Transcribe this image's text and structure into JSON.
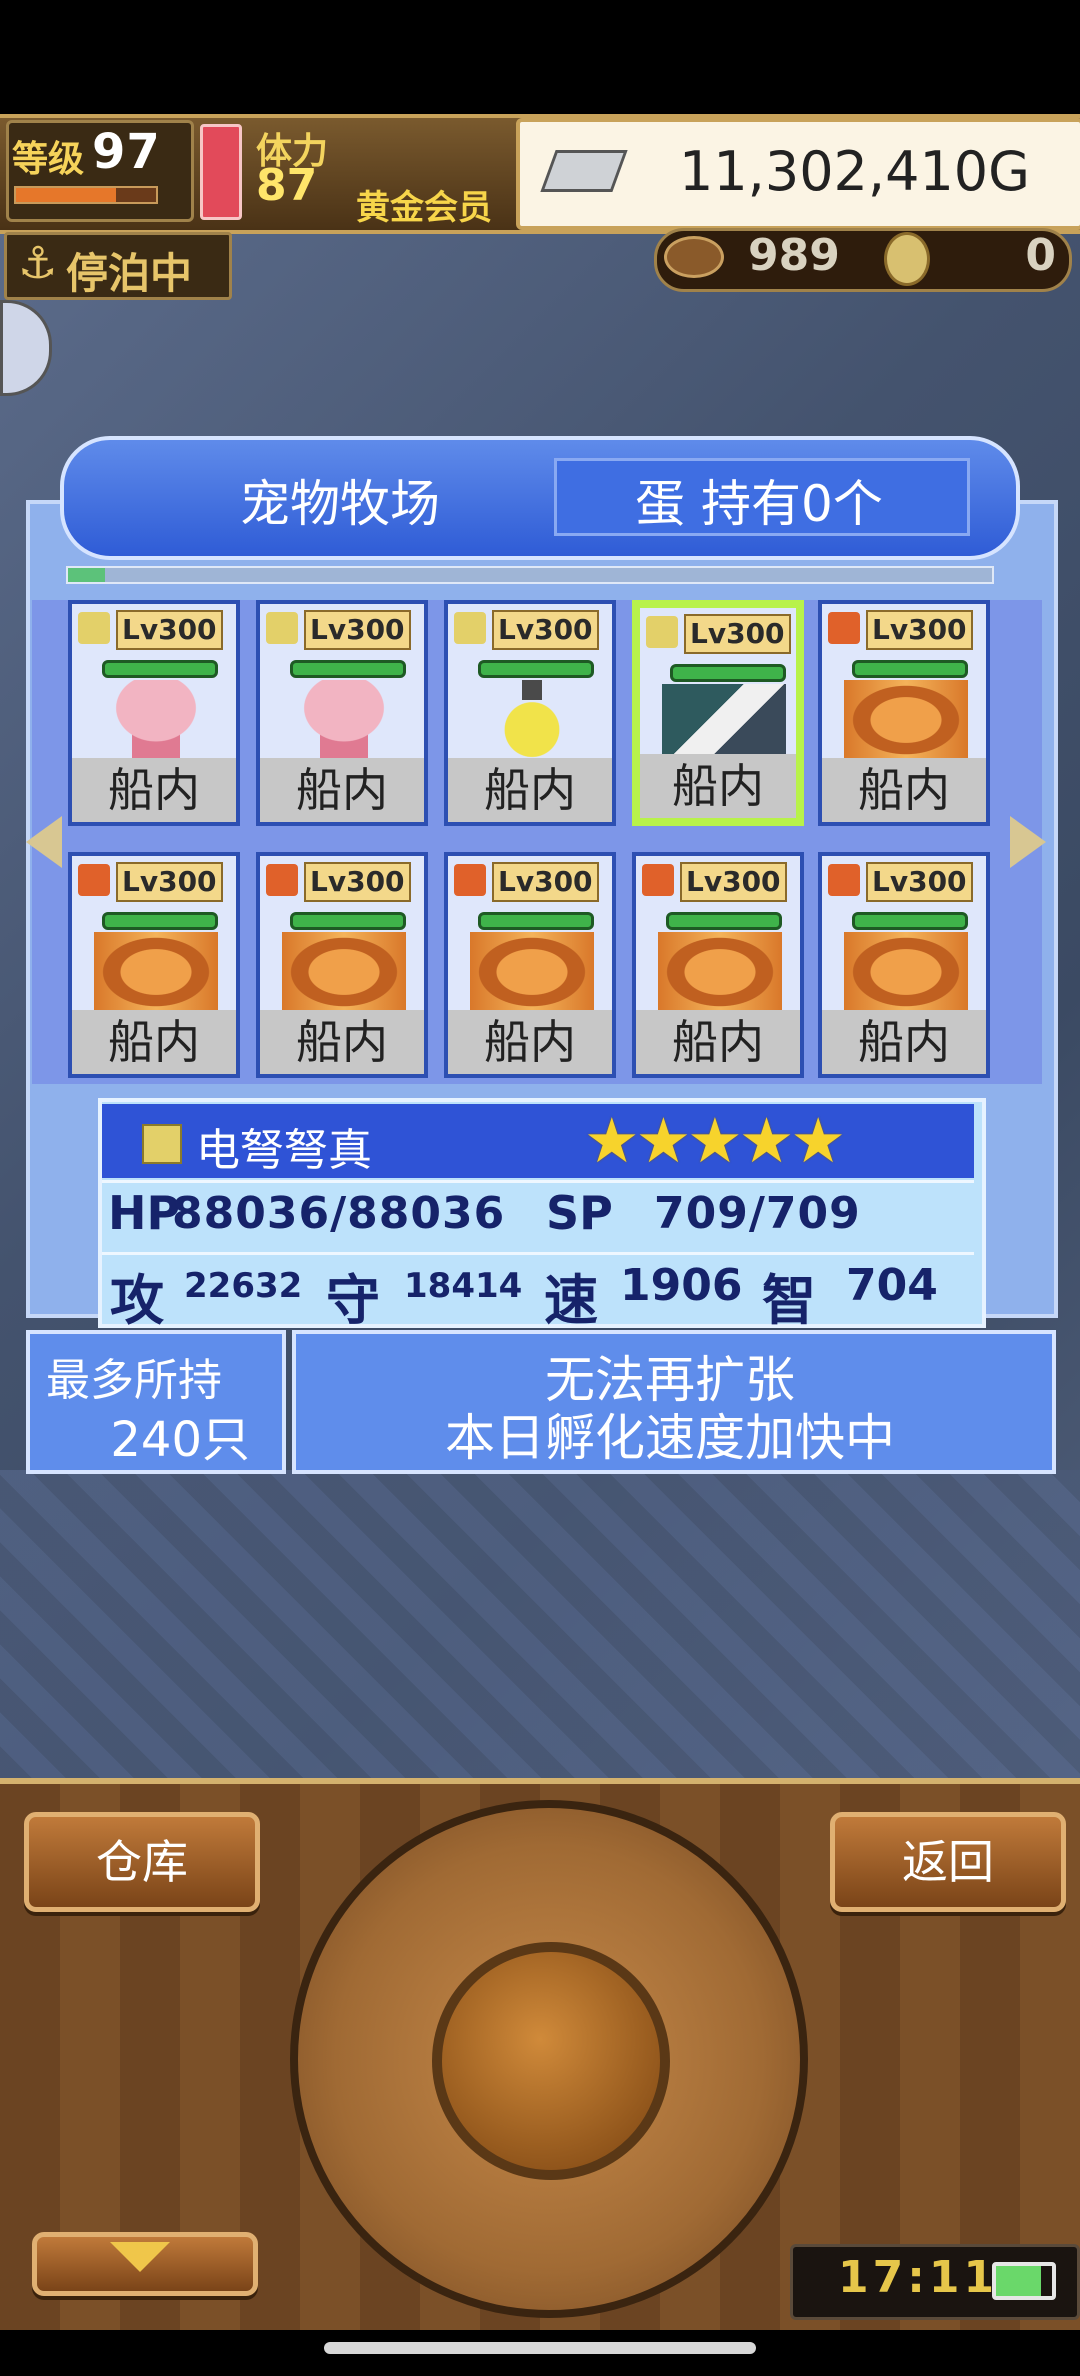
{
  "status": {
    "level_label": "等级",
    "level": "97",
    "stamina_label": "体力",
    "stamina": "87",
    "membership": "黄金会员",
    "gold": "11,302,410G",
    "dock_status": "停泊中",
    "fish": "989",
    "coins": "0"
  },
  "ranch": {
    "title": "宠物牧场",
    "eggs": "蛋 持有0个",
    "progress_fraction": 0.04
  },
  "pets": [
    {
      "level": "Lv300",
      "element": "electric",
      "sprite": "pink-axolotl",
      "location": "船内",
      "selected": false
    },
    {
      "level": "Lv300",
      "element": "electric",
      "sprite": "pink-axolotl",
      "location": "船内",
      "selected": false
    },
    {
      "level": "Lv300",
      "element": "electric",
      "sprite": "yellow-bell",
      "location": "船内",
      "selected": false
    },
    {
      "level": "Lv300",
      "element": "electric",
      "sprite": "teal-griffin",
      "location": "船内",
      "selected": true
    },
    {
      "level": "Lv300",
      "element": "fire",
      "sprite": "orange-dragon",
      "location": "船内",
      "selected": false
    },
    {
      "level": "Lv300",
      "element": "fire",
      "sprite": "orange-dragon",
      "location": "船内",
      "selected": false
    },
    {
      "level": "Lv300",
      "element": "fire",
      "sprite": "orange-dragon",
      "location": "船内",
      "selected": false
    },
    {
      "level": "Lv300",
      "element": "fire",
      "sprite": "orange-dragon",
      "location": "船内",
      "selected": false
    },
    {
      "level": "Lv300",
      "element": "fire",
      "sprite": "orange-dragon",
      "location": "船内",
      "selected": false
    },
    {
      "level": "Lv300",
      "element": "fire",
      "sprite": "orange-dragon",
      "location": "船内",
      "selected": false
    }
  ],
  "selected_pet": {
    "name": "电弩弩真",
    "stars": "★★★★★",
    "hp_label": "HP",
    "hp": "88036/88036",
    "sp_label": "SP",
    "sp": "709/709",
    "atk_label": "攻",
    "atk": "22632",
    "def_label": "守",
    "def": "18414",
    "spd_label": "速",
    "spd": "1906",
    "int_label": "智",
    "int": "704"
  },
  "capacity": {
    "label": "最多所持",
    "value": "240只"
  },
  "message": {
    "line1": "无法再扩张",
    "line2": "本日孵化速度加快中"
  },
  "controls": {
    "warehouse": "仓库",
    "back": "返回",
    "time": "17:11"
  },
  "colors": {
    "electric": "#e3d069",
    "fire": "#e0612a",
    "selected_border": "#b8f24a",
    "panel_blue": "#5f8deb"
  }
}
